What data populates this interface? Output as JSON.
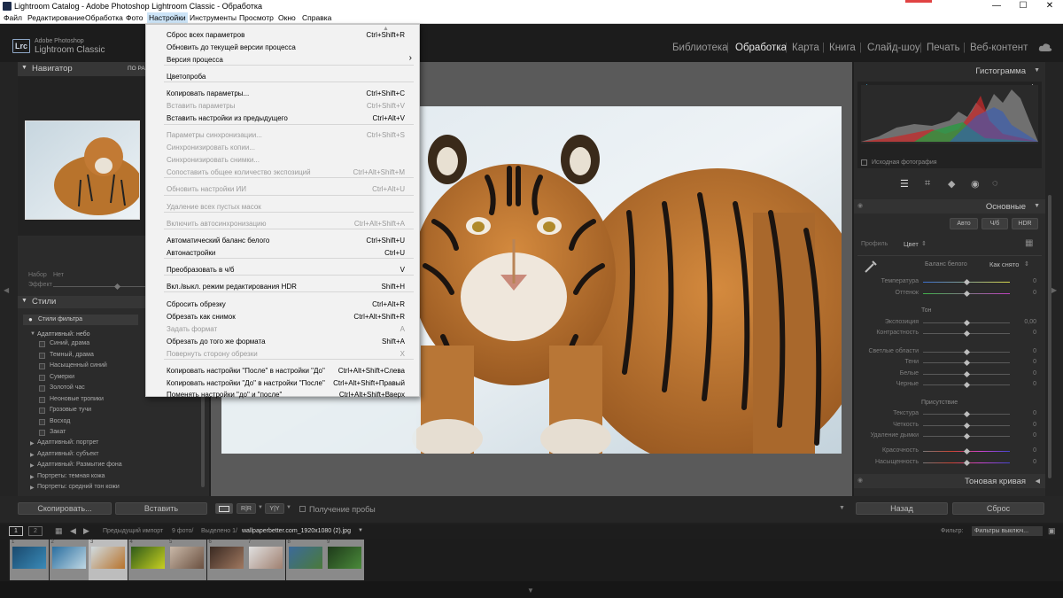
{
  "window": {
    "title": "Lightroom Catalog - Adobe Photoshop Lightroom Classic - Обработка",
    "minimize": "—",
    "maximize": "☐",
    "close": "✕"
  },
  "menubar": [
    "Файл",
    "Редактирование",
    "Обработка",
    "Фото",
    "Настройки",
    "Инструменты",
    "Просмотр",
    "Окно",
    "Справка"
  ],
  "brand": {
    "badge": "Lrc",
    "line1": "Adobe Photoshop",
    "line2": "Lightroom Classic"
  },
  "modules": [
    "Библиотека",
    "Обработка",
    "Карта",
    "Книга",
    "Слайд-шоу",
    "Печать",
    "Веб-контент"
  ],
  "modules_separator": "|",
  "active_module": "Обработка",
  "left": {
    "navigator_title": "Навигатор",
    "navigator_zoom": "ПО РАЗ",
    "preset_label": "Набор",
    "preset_value": "Нет",
    "effect_label": "Эффект",
    "styles_title": "Стили",
    "filter_styles": "Стили фильтра",
    "group_open": "Адаптивный: небо",
    "sky_items": [
      "Синий, драма",
      "Темный, драма",
      "Насыщенный синий",
      "Сумерки",
      "Золотой час",
      "Неоновые тропики",
      "Грозовые тучи",
      "Восход",
      "Закат"
    ],
    "groups": [
      "Адаптивный: портрет",
      "Адаптивный: субъект",
      "Адаптивный: Размытие фона",
      "Портреты: темная кожа",
      "Портреты: средний тон кожи"
    ],
    "copy_button": "Скопировать...",
    "paste_button": "Вставить"
  },
  "toolbar": {
    "soft_proof": "Получение пробы"
  },
  "right": {
    "histogram_title": "Гистограмма",
    "original_photo": "Исходная фотография",
    "basic_title": "Основные",
    "auto": "Авто",
    "bw": "Ч/б",
    "hdr": "HDR",
    "profile_label": "Профиль",
    "profile_value": "Цвет",
    "wb_label": "Баланс белого",
    "wb_value": "Как снято",
    "sliders": [
      {
        "label": "Температура",
        "value": "0"
      },
      {
        "label": "Оттенок",
        "value": "0"
      },
      {
        "label": "Экспозиция",
        "value": "0,00"
      },
      {
        "label": "Контрастность",
        "value": "0"
      },
      {
        "label": "Светлые области",
        "value": "0"
      },
      {
        "label": "Тени",
        "value": "0"
      },
      {
        "label": "Белые",
        "value": "0"
      },
      {
        "label": "Черные",
        "value": "0"
      },
      {
        "label": "Текстура",
        "value": "0"
      },
      {
        "label": "Четкость",
        "value": "0"
      },
      {
        "label": "Удаление дымки",
        "value": "0"
      },
      {
        "label": "Красочность",
        "value": "0"
      },
      {
        "label": "Насыщенность",
        "value": "0"
      }
    ],
    "tone_label": "Тон",
    "presence_label": "Присутствие",
    "tone_curve_title": "Тоновая кривая",
    "back_button": "Назад",
    "reset_button": "Сброс"
  },
  "filmstrip": {
    "view1": "1",
    "view2": "2",
    "source": "Предыдущий импорт",
    "count": "9 фото/",
    "selected": "Выделено 1/",
    "filename": "wallpaperbetter.com_1920x1080 (2).jpg",
    "filter_label": "Фильтр:",
    "filter_value": "Фильтры выключ...",
    "numbers": [
      "1",
      "2",
      "3",
      "4",
      "5",
      "6",
      "7",
      "8",
      "9"
    ]
  },
  "dropdown": {
    "items": [
      {
        "label": "Сброс всех параметров",
        "shortcut": "Ctrl+Shift+R",
        "disabled": false
      },
      {
        "label": "Обновить до текущей версии процесса",
        "shortcut": "",
        "disabled": false
      },
      {
        "label": "Версия процесса",
        "shortcut": "›",
        "disabled": false
      },
      {
        "label": "Цветопроба",
        "shortcut": "",
        "disabled": false
      },
      {
        "label": "Копировать параметры...",
        "shortcut": "Ctrl+Shift+C",
        "disabled": false
      },
      {
        "label": "Вставить параметры",
        "shortcut": "Ctrl+Shift+V",
        "disabled": true
      },
      {
        "label": "Вставить настройки из предыдущего",
        "shortcut": "Ctrl+Alt+V",
        "disabled": false
      },
      {
        "label": "Параметры синхронизации...",
        "shortcut": "Ctrl+Shift+S",
        "disabled": true
      },
      {
        "label": "Синхронизировать копии...",
        "shortcut": "",
        "disabled": true
      },
      {
        "label": "Синхронизировать снимки...",
        "shortcut": "",
        "disabled": true
      },
      {
        "label": "Сопоставить общее количество экспозиций",
        "shortcut": "Ctrl+Alt+Shift+M",
        "disabled": true
      },
      {
        "label": "Обновить настройки ИИ",
        "shortcut": "Ctrl+Alt+U",
        "disabled": true
      },
      {
        "label": "Удаление всех пустых масок",
        "shortcut": "",
        "disabled": true
      },
      {
        "label": "Включить автосинхронизацию",
        "shortcut": "Ctrl+Alt+Shift+A",
        "disabled": true
      },
      {
        "label": "Автоматический баланс белого",
        "shortcut": "Ctrl+Shift+U",
        "disabled": false
      },
      {
        "label": "Автонастройки",
        "shortcut": "Ctrl+U",
        "disabled": false
      },
      {
        "label": "Преобразовать в ч/б",
        "shortcut": "V",
        "disabled": false
      },
      {
        "label": "Вкл./выкл. режим редактирования HDR",
        "shortcut": "Shift+H",
        "disabled": false
      },
      {
        "label": "Сбросить обрезку",
        "shortcut": "Ctrl+Alt+R",
        "disabled": false
      },
      {
        "label": "Обрезать как снимок",
        "shortcut": "Ctrl+Alt+Shift+R",
        "disabled": false
      },
      {
        "label": "Задать формат",
        "shortcut": "A",
        "disabled": true
      },
      {
        "label": "Обрезать до того же формата",
        "shortcut": "Shift+A",
        "disabled": false
      },
      {
        "label": "Повернуть сторону обрезки",
        "shortcut": "X",
        "disabled": true
      },
      {
        "label": "Копировать настройки \"После\" в настройки \"До\"",
        "shortcut": "Ctrl+Alt+Shift+Слева",
        "disabled": false
      },
      {
        "label": "Копировать настройки \"До\" в настройки \"После\"",
        "shortcut": "Ctrl+Alt+Shift+Правый",
        "disabled": false
      },
      {
        "label": "Поменять настройки \"до\" и \"после\"",
        "shortcut": "Ctrl+Alt+Shift+Вверх",
        "disabled": false
      }
    ]
  }
}
